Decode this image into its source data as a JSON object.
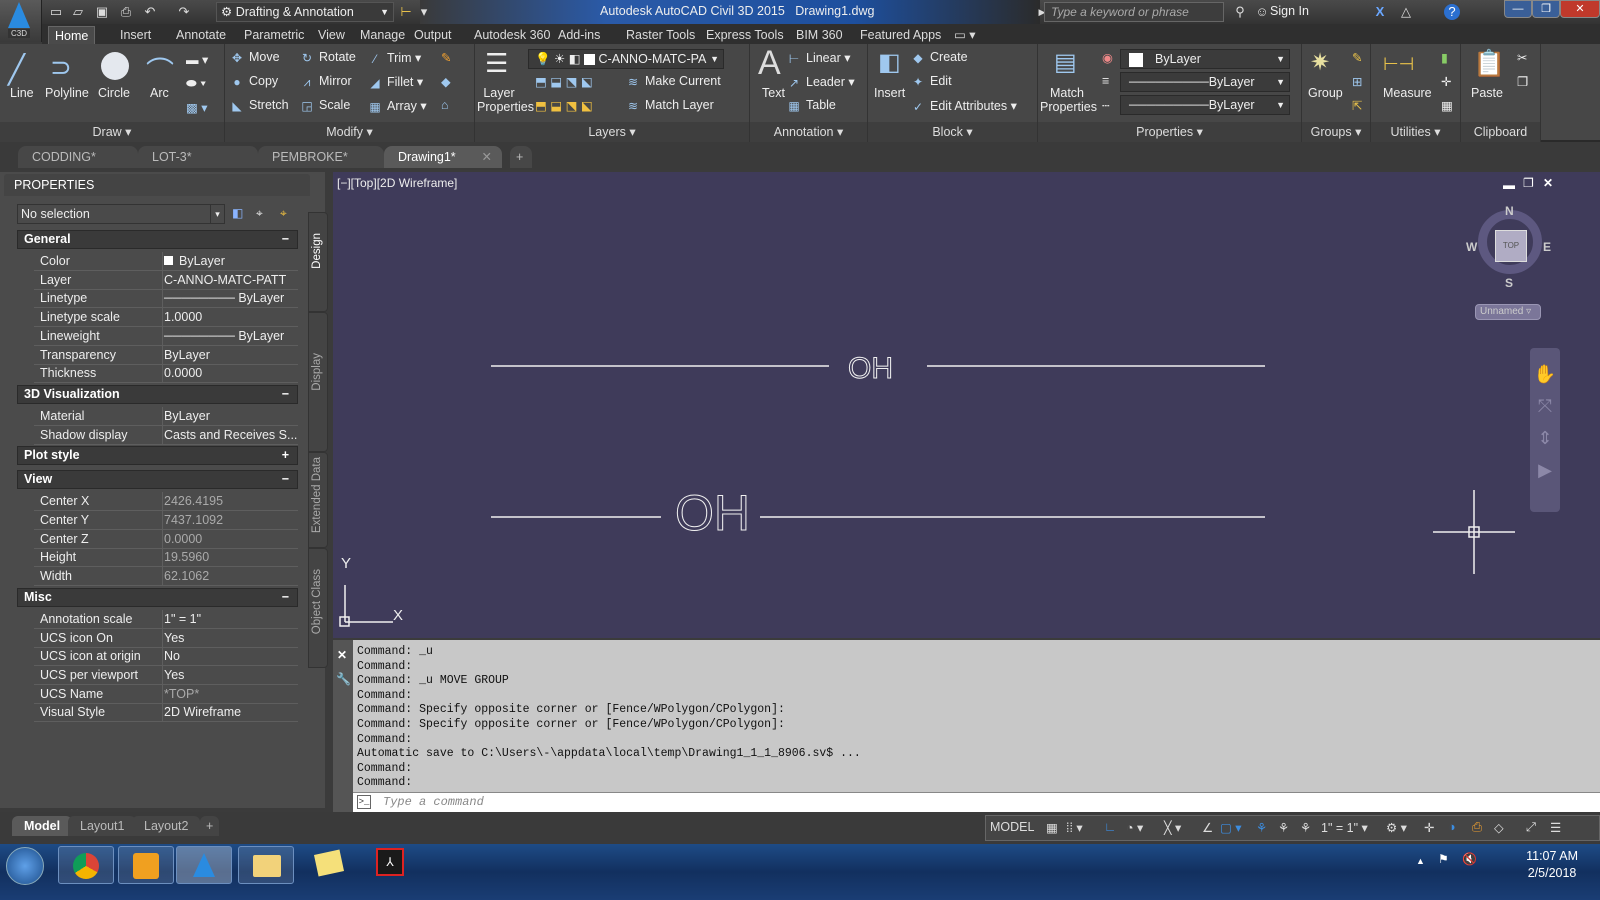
{
  "app": {
    "badge": "C3D",
    "title": "Autodesk AutoCAD Civil 3D 2015",
    "file": "Drawing1.dwg",
    "workspace": "Drafting & Annotation",
    "search_placeholder": "Type a keyword or phrase",
    "sign_in": "Sign In"
  },
  "menu_tabs": [
    "Home",
    "Insert",
    "Annotate",
    "Parametric",
    "View",
    "Manage",
    "Output",
    "Autodesk 360",
    "Add-ins",
    "Raster Tools",
    "Express Tools",
    "BIM 360",
    "Featured Apps"
  ],
  "ribbon": {
    "draw": {
      "title": "Draw",
      "items": [
        "Line",
        "Polyline",
        "Circle",
        "Arc"
      ]
    },
    "modify": {
      "title": "Modify",
      "items": [
        "Move",
        "Rotate",
        "Trim",
        "Copy",
        "Mirror",
        "Fillet",
        "Stretch",
        "Scale",
        "Array"
      ]
    },
    "layers": {
      "title": "Layers",
      "layer_properties": "Layer Properties",
      "current_layer": "C-ANNO-MATC-PA",
      "make_current": "Make Current",
      "match_layer": "Match Layer"
    },
    "annotation": {
      "title": "Annotation",
      "text": "Text",
      "linear": "Linear",
      "leader": "Leader",
      "table": "Table"
    },
    "block": {
      "title": "Block",
      "insert": "Insert",
      "create": "Create",
      "edit": "Edit",
      "edit_attributes": "Edit Attributes"
    },
    "properties": {
      "title": "Properties",
      "match": "Match Properties",
      "color": "ByLayer",
      "lineweight": "ByLayer",
      "linetype": "ByLayer"
    },
    "groups": {
      "title": "Groups",
      "group": "Group"
    },
    "utilities": {
      "title": "Utilities",
      "measure": "Measure"
    },
    "clipboard": {
      "title": "Clipboard",
      "paste": "Paste"
    }
  },
  "file_tabs": [
    "CODDING*",
    "LOT-3*",
    "PEMBROKE*",
    "Drawing1*"
  ],
  "properties_panel": {
    "title": "PROPERTIES",
    "selection": "No selection",
    "side_tabs": [
      "Design",
      "Display",
      "Extended Data",
      "Object Class"
    ],
    "sections": [
      {
        "name": "General",
        "toggle": "−",
        "rows": [
          {
            "k": "Color",
            "v": "ByLayer"
          },
          {
            "k": "Layer",
            "v": "C-ANNO-MATC-PATT"
          },
          {
            "k": "Linetype",
            "v": "ByLayer"
          },
          {
            "k": "Linetype scale",
            "v": "1.0000"
          },
          {
            "k": "Lineweight",
            "v": "ByLayer"
          },
          {
            "k": "Transparency",
            "v": "ByLayer"
          },
          {
            "k": "Thickness",
            "v": "0.0000"
          }
        ]
      },
      {
        "name": "3D Visualization",
        "toggle": "−",
        "rows": [
          {
            "k": "Material",
            "v": "ByLayer"
          },
          {
            "k": "Shadow display",
            "v": "Casts and Receives S..."
          }
        ]
      },
      {
        "name": "Plot style",
        "toggle": "+",
        "rows": []
      },
      {
        "name": "View",
        "toggle": "−",
        "rows": [
          {
            "k": "Center X",
            "v": "2426.4195"
          },
          {
            "k": "Center Y",
            "v": "7437.1092"
          },
          {
            "k": "Center Z",
            "v": "0.0000"
          },
          {
            "k": "Height",
            "v": "19.5960"
          },
          {
            "k": "Width",
            "v": "62.1062"
          }
        ]
      },
      {
        "name": "Misc",
        "toggle": "−",
        "rows": [
          {
            "k": "Annotation scale",
            "v": "1\" = 1\""
          },
          {
            "k": "UCS icon On",
            "v": "Yes"
          },
          {
            "k": "UCS icon at origin",
            "v": "No"
          },
          {
            "k": "UCS per viewport",
            "v": "Yes"
          },
          {
            "k": "UCS Name",
            "v": "*TOP*"
          },
          {
            "k": "Visual Style",
            "v": "2D Wireframe"
          }
        ]
      }
    ]
  },
  "viewport": {
    "label": "[−][Top][2D Wireframe]",
    "viewcube": {
      "n": "N",
      "s": "S",
      "e": "E",
      "w": "W",
      "face": "TOP",
      "ucs": "Unnamed"
    },
    "drawing_text": [
      "OH",
      "OH"
    ],
    "ucs": {
      "x": "X",
      "y": "Y"
    }
  },
  "command_history": [
    "Command: _u",
    "Command:",
    "Command: _u MOVE GROUP",
    "Command:",
    "Command: Specify opposite corner or [Fence/WPolygon/CPolygon]:",
    "Command: Specify opposite corner or [Fence/WPolygon/CPolygon]:",
    "Command:",
    "Automatic save to C:\\Users\\-\\appdata\\local\\temp\\Drawing1_1_1_8906.sv$ ...",
    "Command:",
    "Command:"
  ],
  "command_placeholder": "Type a command",
  "layout_tabs": [
    "Model",
    "Layout1",
    "Layout2"
  ],
  "status": {
    "model": "MODEL",
    "scale": "1\" = 1\""
  },
  "taskbar": {
    "time": "11:07 AM",
    "date": "2/5/2018"
  }
}
